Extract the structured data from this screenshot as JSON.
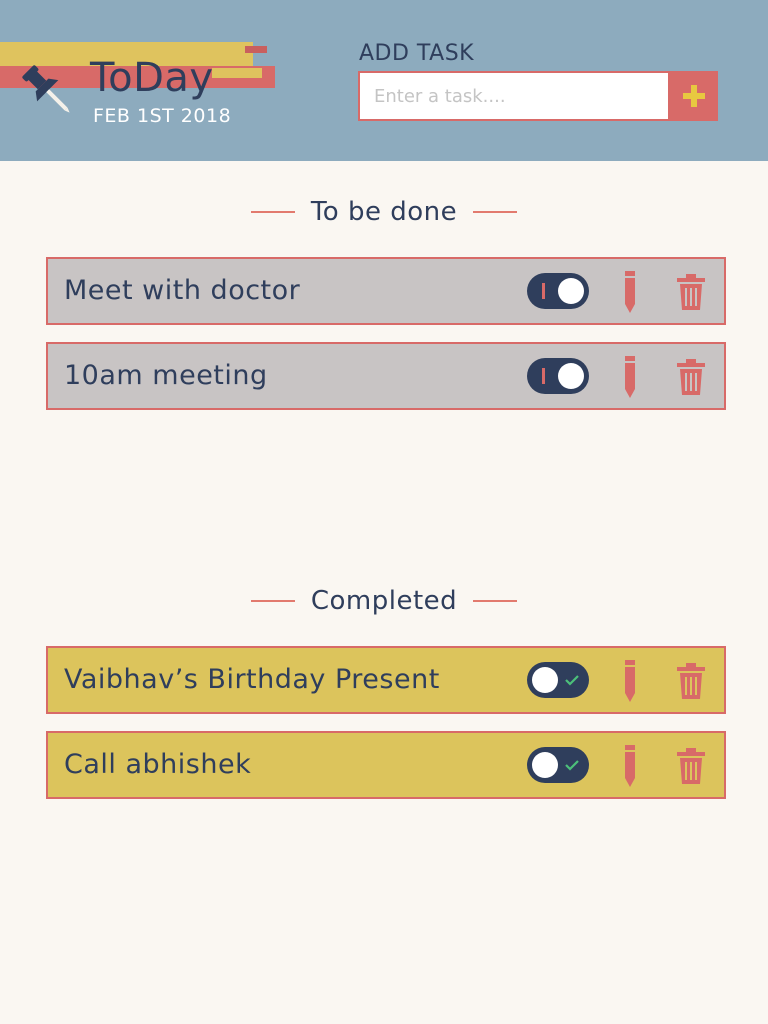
{
  "app": {
    "title": "ToDay",
    "date": "FEB 1ST 2018"
  },
  "add_task": {
    "label": "ADD TASK",
    "placeholder": "Enter a task....",
    "value": "",
    "button_icon": "plus-icon"
  },
  "sections": {
    "todo": {
      "heading": "To be done",
      "tasks": [
        {
          "text": "Meet with doctor",
          "completed": false
        },
        {
          "text": "10am meeting",
          "completed": false
        }
      ]
    },
    "completed": {
      "heading": "Completed",
      "tasks": [
        {
          "text": "Vaibhav’s Birthday Present",
          "completed": true
        },
        {
          "text": "Call abhishek",
          "completed": true
        }
      ]
    }
  },
  "colors": {
    "header_bg": "#8dabbe",
    "page_bg": "#faf7f2",
    "navy": "#2f3e5c",
    "coral": "#d86a68",
    "mustard": "#dcc45c",
    "grey_row": "#c8c4c4",
    "check_green": "#4cc07a"
  },
  "icons": {
    "logo": "pushpin-icon",
    "edit": "pencil-icon",
    "delete": "trash-icon",
    "done_mark": "check-icon"
  }
}
